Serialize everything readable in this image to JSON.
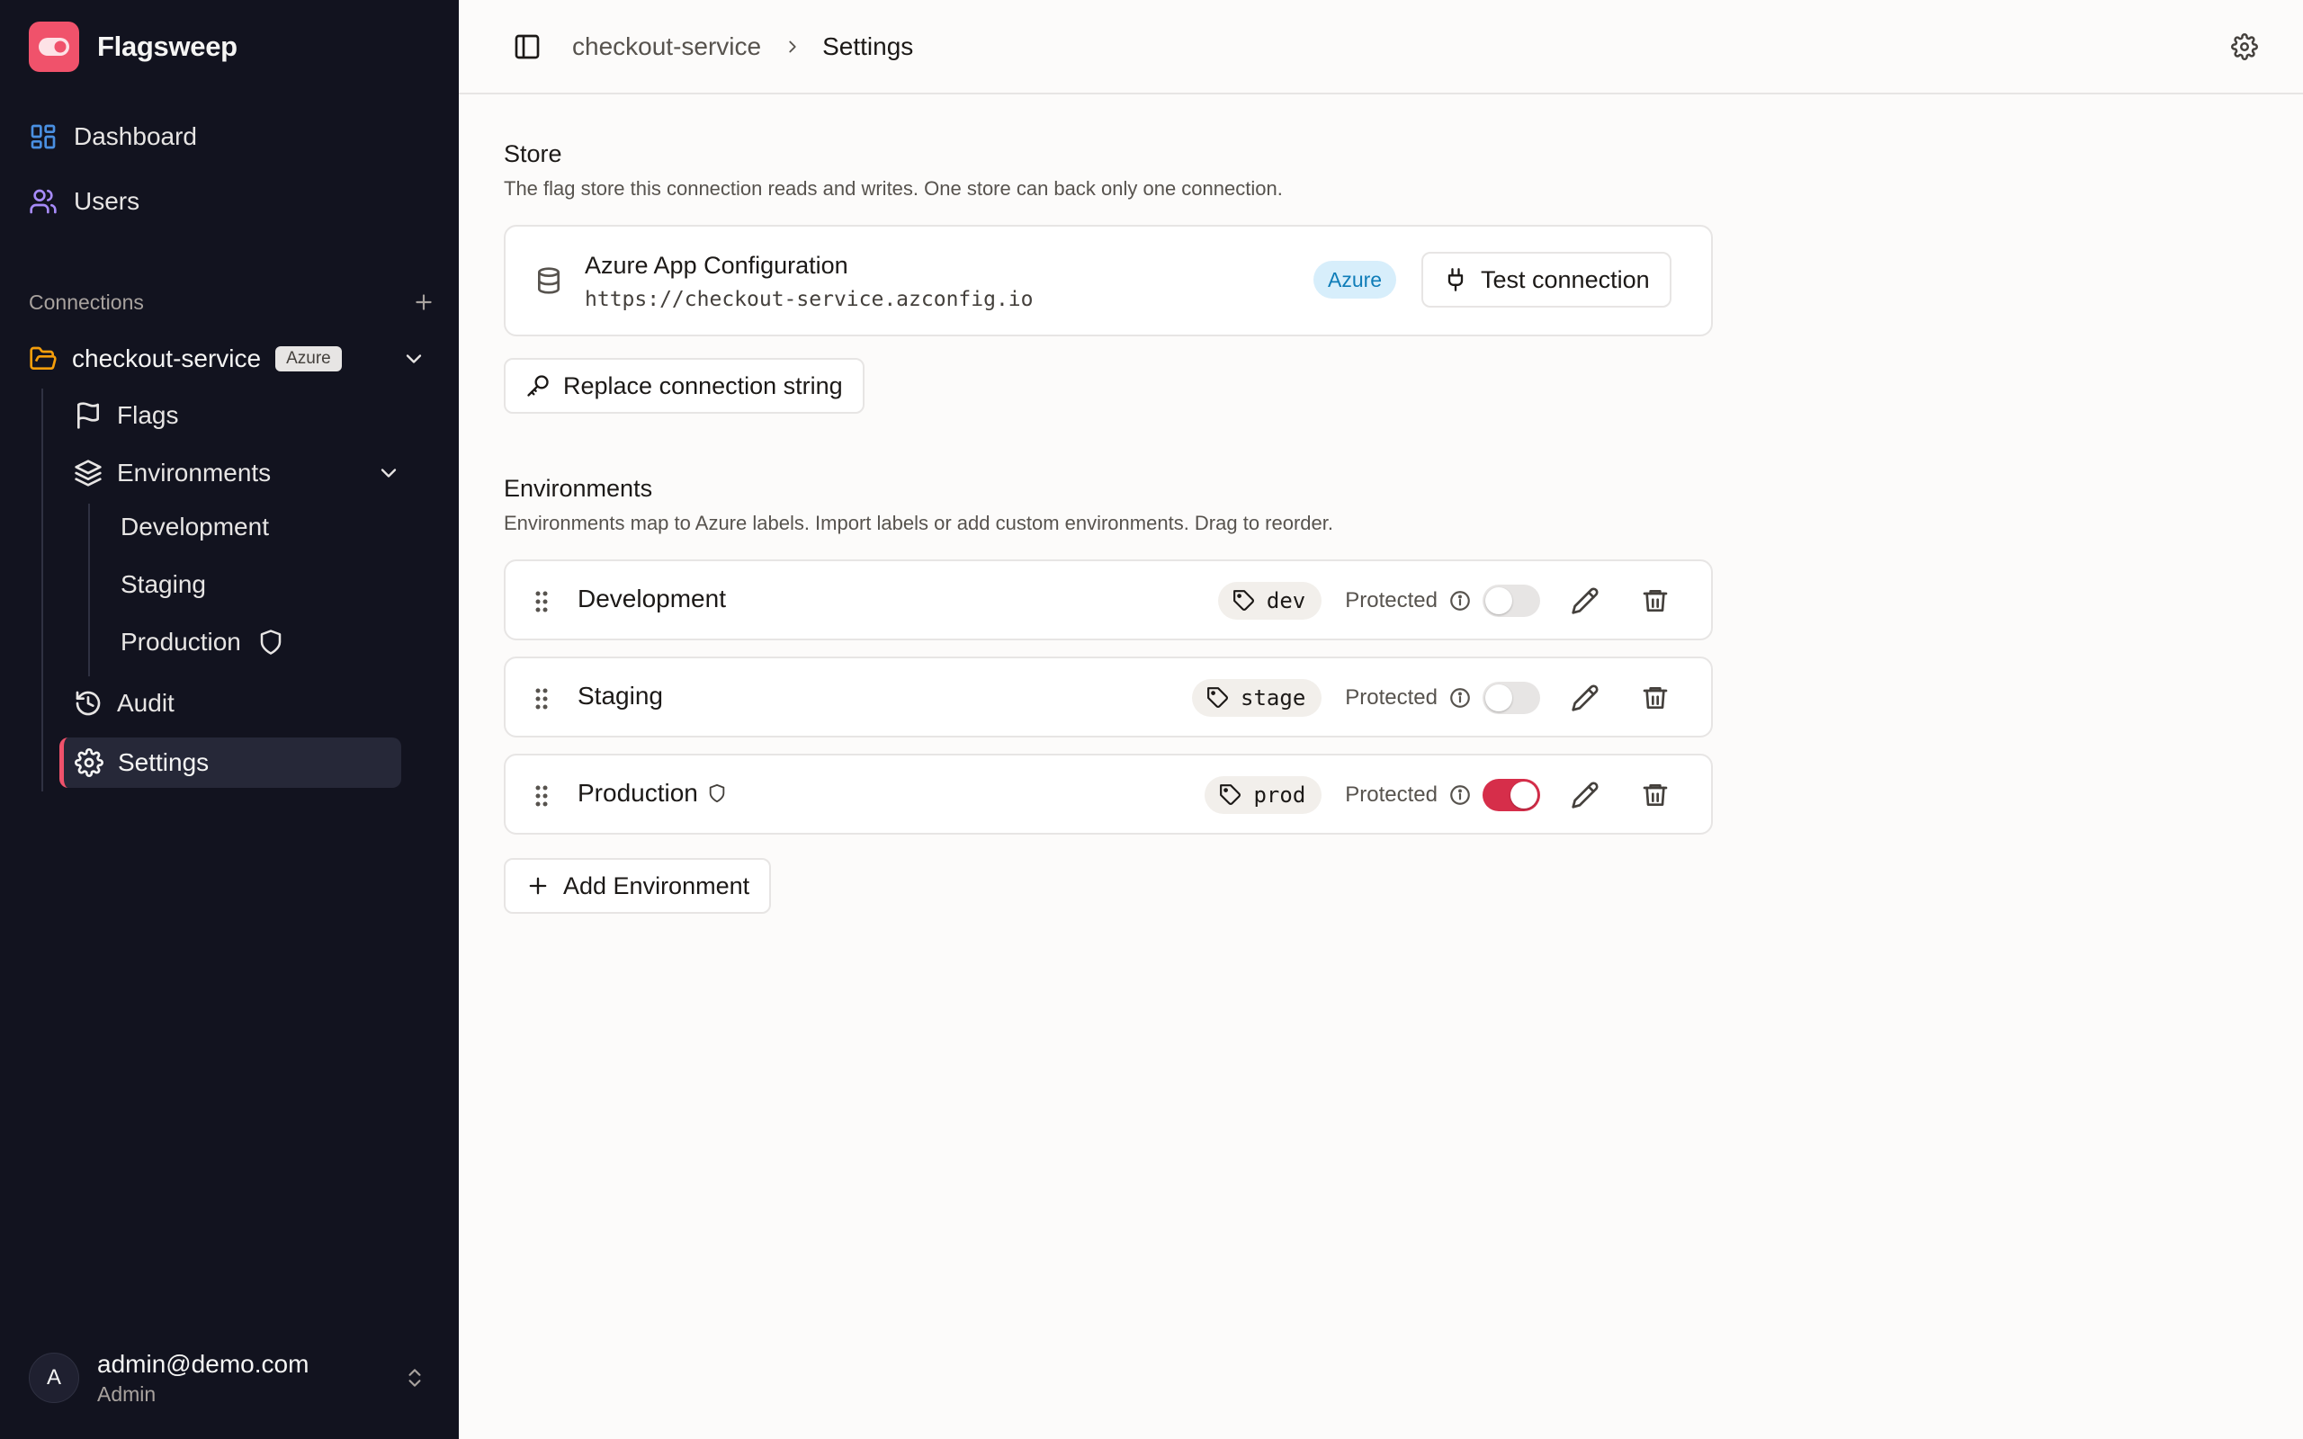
{
  "app": {
    "name": "Flagsweep"
  },
  "colors": {
    "accent": "#f0526b",
    "sidebar_bg": "#12131f",
    "toggle_on": "#d62e4a",
    "azure_pill_bg": "#d7eefb",
    "azure_pill_text": "#0f7db8"
  },
  "sidebar": {
    "nav": [
      {
        "label": "Dashboard",
        "icon": "layout-dashboard-icon"
      },
      {
        "label": "Users",
        "icon": "users-icon"
      }
    ],
    "connections_label": "Connections",
    "connection": {
      "name": "checkout-service",
      "badge": "Azure",
      "items": {
        "flags": "Flags",
        "environments": "Environments",
        "audit": "Audit",
        "settings": "Settings"
      },
      "environments": [
        "Development",
        "Staging",
        "Production"
      ]
    },
    "user": {
      "initial": "A",
      "email": "admin@demo.com",
      "role": "Admin"
    }
  },
  "header": {
    "breadcrumb": [
      "checkout-service",
      "Settings"
    ]
  },
  "store": {
    "title": "Store",
    "description": "The flag store this connection reads and writes. One store can back only one connection.",
    "name": "Azure App Configuration",
    "url": "https://checkout-service.azconfig.io",
    "badge": "Azure",
    "test_button": "Test connection",
    "replace_button": "Replace connection string"
  },
  "environments": {
    "title": "Environments",
    "description": "Environments map to Azure labels. Import labels or add custom environments. Drag to reorder.",
    "protected_label": "Protected",
    "rows": [
      {
        "name": "Development",
        "label": "dev",
        "protected": false
      },
      {
        "name": "Staging",
        "label": "stage",
        "protected": false
      },
      {
        "name": "Production",
        "label": "prod",
        "protected": true
      }
    ],
    "add_button": "Add Environment"
  }
}
